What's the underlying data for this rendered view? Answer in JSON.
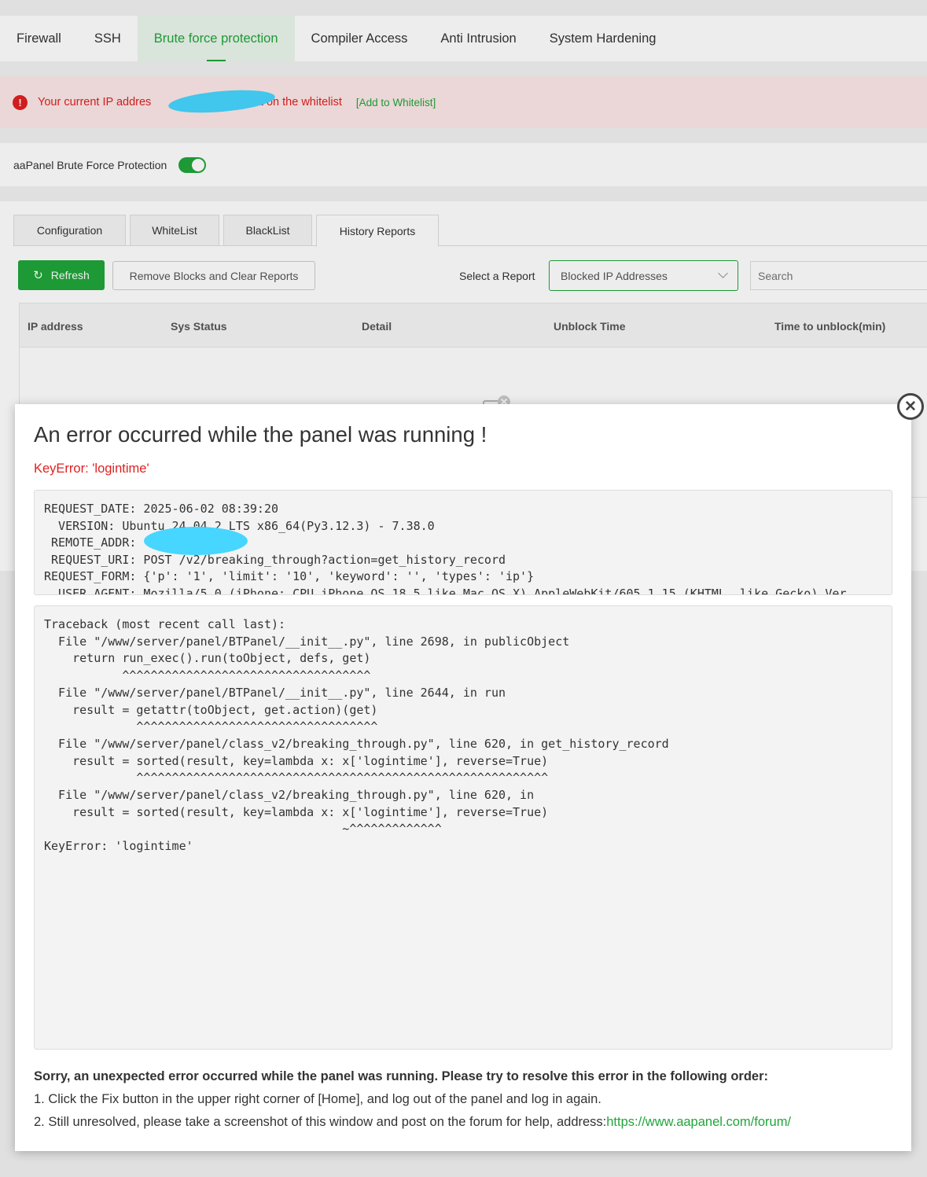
{
  "nav": {
    "tabs": [
      {
        "label": "Firewall"
      },
      {
        "label": "SSH"
      },
      {
        "label": "Brute force protection"
      },
      {
        "label": "Compiler Access"
      },
      {
        "label": "Anti Intrusion"
      },
      {
        "label": "System Hardening"
      }
    ],
    "active_index": 2
  },
  "alert": {
    "icon": "exclamation-icon",
    "text_before": "Your current IP addres",
    "text_after": "is not on the whitelist",
    "link": "[Add to Whitelist]"
  },
  "protection": {
    "label": "aaPanel Brute Force Protection",
    "enabled": true
  },
  "subtabs": [
    "Configuration",
    "WhiteList",
    "BlackList",
    "History Reports"
  ],
  "toolbar": {
    "refresh": "Refresh",
    "remove": "Remove Blocks and Clear Reports",
    "select_label": "Select a Report",
    "select_value": "Blocked IP Addresses",
    "search_placeholder": "Search"
  },
  "table": {
    "columns": [
      "IP address",
      "Sys Status",
      "Detail",
      "Unblock Time",
      "Time to unblock(min)"
    ],
    "rows": []
  },
  "modal": {
    "title": "An error occurred while the panel was running !",
    "error": "KeyError: 'logintime'",
    "request_info": "REQUEST_DATE: 2025-06-02 08:39:20\n  VERSION: Ubuntu 24.04.2 LTS x86_64(Py3.12.3) - 7.38.0\n REMOTE_ADDR: \n REQUEST_URI: POST /v2/breaking_through?action=get_history_record\nREQUEST_FORM: {'p': '1', 'limit': '10', 'keyword': '', 'types': 'ip'}\n  USER_AGENT: Mozilla/5.0 (iPhone; CPU iPhone OS 18_5 like Mac OS X) AppleWebKit/605.1.15 (KHTML, like Gecko) Ver",
    "traceback": "Traceback (most recent call last):\n  File \"/www/server/panel/BTPanel/__init__.py\", line 2698, in publicObject\n    return run_exec().run(toObject, defs, get)\n           ^^^^^^^^^^^^^^^^^^^^^^^^^^^^^^^^^^^\n  File \"/www/server/panel/BTPanel/__init__.py\", line 2644, in run\n    result = getattr(toObject, get.action)(get)\n             ^^^^^^^^^^^^^^^^^^^^^^^^^^^^^^^^^^\n  File \"/www/server/panel/class_v2/breaking_through.py\", line 620, in get_history_record\n    result = sorted(result, key=lambda x: x['logintime'], reverse=True)\n             ^^^^^^^^^^^^^^^^^^^^^^^^^^^^^^^^^^^^^^^^^^^^^^^^^^^^^^^^^^\n  File \"/www/server/panel/class_v2/breaking_through.py\", line 620, in \n    result = sorted(result, key=lambda x: x['logintime'], reverse=True)\n                                          ~^^^^^^^^^^^^^\nKeyError: 'logintime'",
    "help_title": "Sorry, an unexpected error occurred while the panel was running. Please try to resolve this error in the following order:",
    "step1": "1. Click the Fix button in the upper right corner of [Home], and log out of the panel and log in again.",
    "step2": "2. Still unresolved, please take a screenshot of this window and post on the forum for help, address:",
    "forum_link": "https://www.aapanel.com/forum/"
  },
  "colors": {
    "accent": "#20a53a",
    "error": "#e02020",
    "redaction": "#46d6ff"
  }
}
